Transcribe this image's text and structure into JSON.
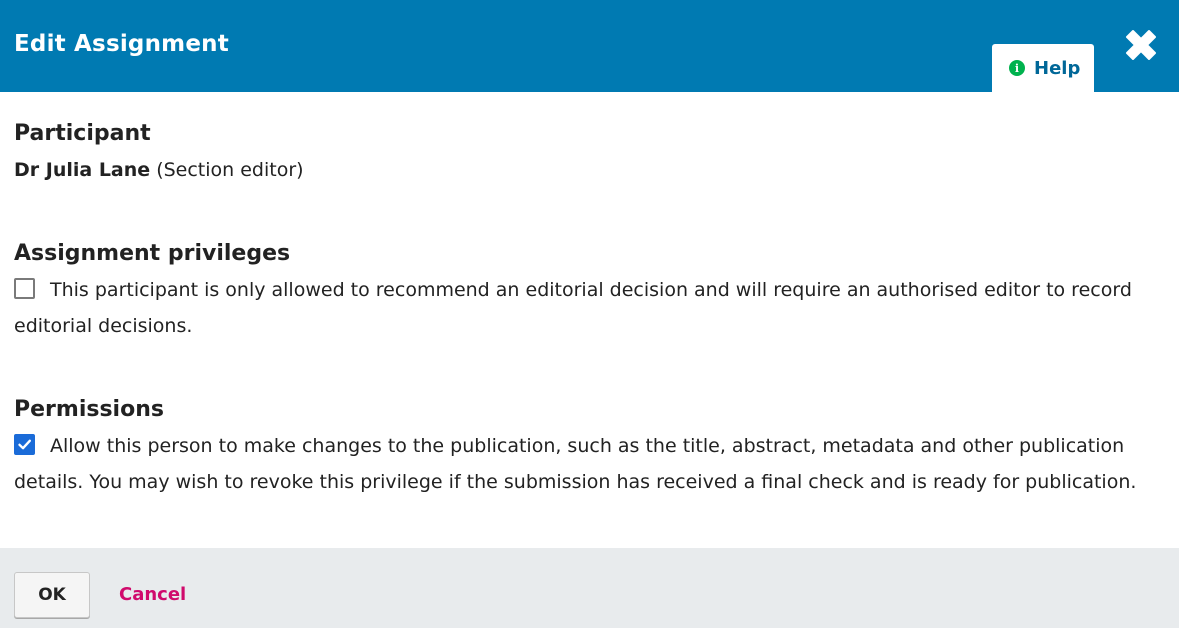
{
  "modal": {
    "title": "Edit Assignment",
    "help_label": "Help",
    "close_icon": "close-icon",
    "help_icon": "info-circle-icon"
  },
  "participant": {
    "heading": "Participant",
    "name": "Dr Julia Lane",
    "role": "(Section editor)"
  },
  "privileges": {
    "heading": "Assignment privileges",
    "checkbox_label": "This participant is only allowed to recommend an editorial decision and will require an authorised editor to record editorial decisions.",
    "checked": false
  },
  "permissions": {
    "heading": "Permissions",
    "checkbox_label": "Allow this person to make changes to the publication, such as the title, abstract, metadata and other publication details. You may wish to revoke this privilege if the submission has received a final check and is ready for publication.",
    "checked": true
  },
  "footer": {
    "ok_label": "OK",
    "cancel_label": "Cancel"
  },
  "colors": {
    "header_bg": "#007ab2",
    "help_text": "#006798",
    "help_icon": "#00b24e",
    "cancel_link": "#d00a6c",
    "checkbox_checked": "#1a6bd8",
    "footer_bg": "#e8ebed"
  }
}
